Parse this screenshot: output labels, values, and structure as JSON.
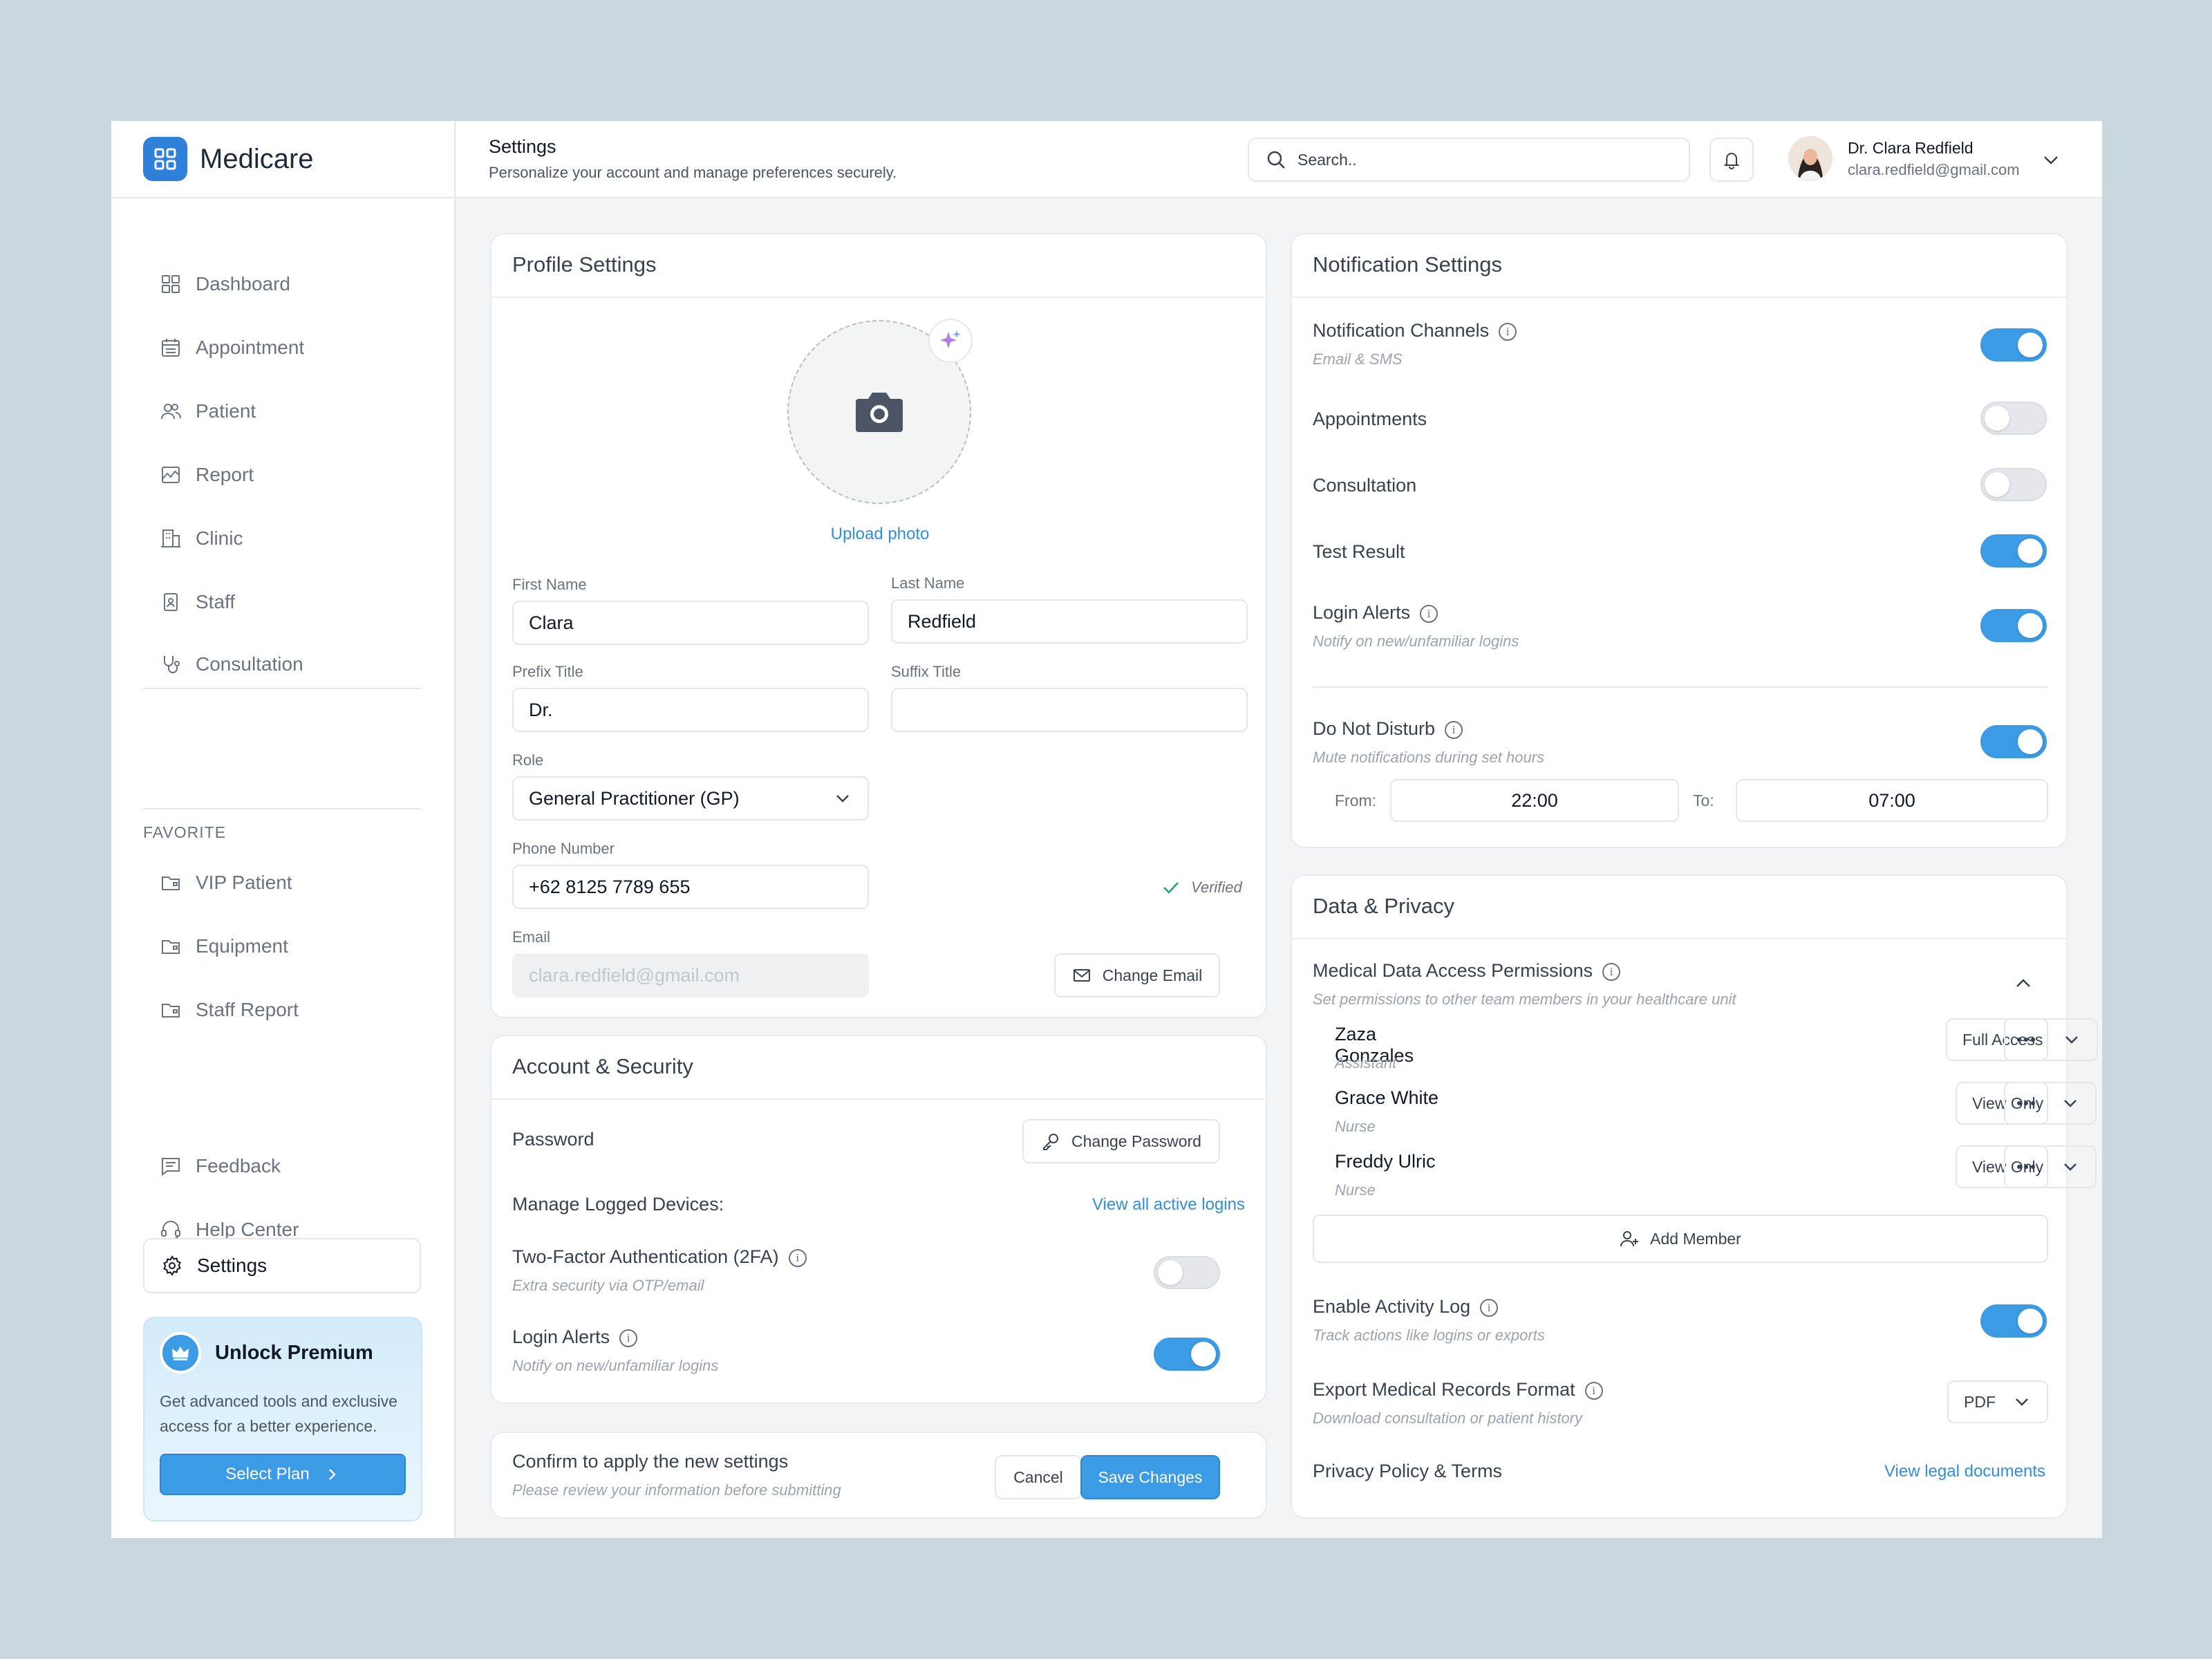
{
  "brand": {
    "name": "Medicare"
  },
  "nav": {
    "items": [
      {
        "label": "Dashboard"
      },
      {
        "label": "Appointment"
      },
      {
        "label": "Patient"
      },
      {
        "label": "Report"
      },
      {
        "label": "Clinic"
      },
      {
        "label": "Staff"
      },
      {
        "label": "Consultation"
      }
    ],
    "favorite_label": "FAVORITE",
    "favorites": [
      {
        "label": "VIP Patient"
      },
      {
        "label": "Equipment"
      },
      {
        "label": "Staff Report"
      }
    ],
    "bottom": [
      {
        "label": "Feedback"
      },
      {
        "label": "Help Center"
      },
      {
        "label": "Settings"
      }
    ]
  },
  "premium": {
    "title": "Unlock Premium",
    "description": "Get advanced tools and exclusive access for a better experience.",
    "button": "Select Plan"
  },
  "header": {
    "title": "Settings",
    "subtitle": "Personalize your account and manage preferences securely.",
    "search_placeholder": "Search..",
    "user_name": "Dr. Clara Redfield",
    "user_email": "clara.redfield@gmail.com"
  },
  "profile": {
    "title": "Profile Settings",
    "upload_label": "Upload photo",
    "first_name_label": "First Name",
    "first_name": "Clara",
    "last_name_label": "Last Name",
    "last_name": "Redfield",
    "prefix_label": "Prefix Title",
    "prefix": "Dr.",
    "suffix_label": "Suffix Title",
    "suffix": "",
    "role_label": "Role",
    "role": "General Practitioner (GP)",
    "phone_label": "Phone Number",
    "phone": "+62 8125 7789 655",
    "verified": "Verified",
    "email_label": "Email",
    "email": "clara.redfield@gmail.com",
    "change_email": "Change Email"
  },
  "security": {
    "title": "Account & Security",
    "password_label": "Password",
    "change_password": "Change Password",
    "devices_label": "Manage Logged Devices:",
    "view_logins": "View all active logins",
    "twofa_label": "Two-Factor Authentication (2FA)",
    "twofa_sub": "Extra security via OTP/email",
    "twofa_on": false,
    "login_alerts_label": "Login Alerts",
    "login_alerts_sub": "Notify on new/unfamiliar logins",
    "login_alerts_on": true
  },
  "confirm": {
    "title": "Confirm to apply the new settings",
    "sub": "Please review your information before submitting",
    "cancel": "Cancel",
    "save": "Save Changes"
  },
  "notifications": {
    "title": "Notification Settings",
    "channels_label": "Notification Channels",
    "channels_sub": "Email & SMS",
    "channels_on": true,
    "appointments_label": "Appointments",
    "appointments_on": false,
    "consultation_label": "Consultation",
    "consultation_on": false,
    "test_result_label": "Test Result",
    "test_result_on": true,
    "login_alerts_label": "Login Alerts",
    "login_alerts_sub": "Notify on new/unfamiliar logins",
    "login_alerts_on": true,
    "dnd_label": "Do Not Disturb",
    "dnd_sub": "Mute notifications during set hours",
    "dnd_on": true,
    "from_label": "From:",
    "from": "22:00",
    "to_label": "To:",
    "to": "07:00"
  },
  "privacy": {
    "title": "Data & Privacy",
    "access_label": "Medical Data Access Permissions",
    "access_sub": "Set permissions to other team members in your healthcare unit",
    "members": [
      {
        "name": "Zaza Gonzales",
        "role": "Assistant",
        "access": "Full Access"
      },
      {
        "name": "Grace White",
        "role": "Nurse",
        "access": "View Only"
      },
      {
        "name": "Freddy Ulric",
        "role": "Nurse",
        "access": "View Only"
      }
    ],
    "add_member": "Add Member",
    "activity_label": "Enable Activity Log",
    "activity_sub": "Track actions like logins or exports",
    "activity_on": true,
    "export_label": "Export Medical Records Format",
    "export_sub": "Download consultation or patient history",
    "export_format": "PDF",
    "policy_label": "Privacy Policy & Terms",
    "policy_link": "View legal documents"
  },
  "colors": {
    "accent": "#3b9be5",
    "link": "#2f8fdc",
    "brand": "#2f80d8"
  }
}
